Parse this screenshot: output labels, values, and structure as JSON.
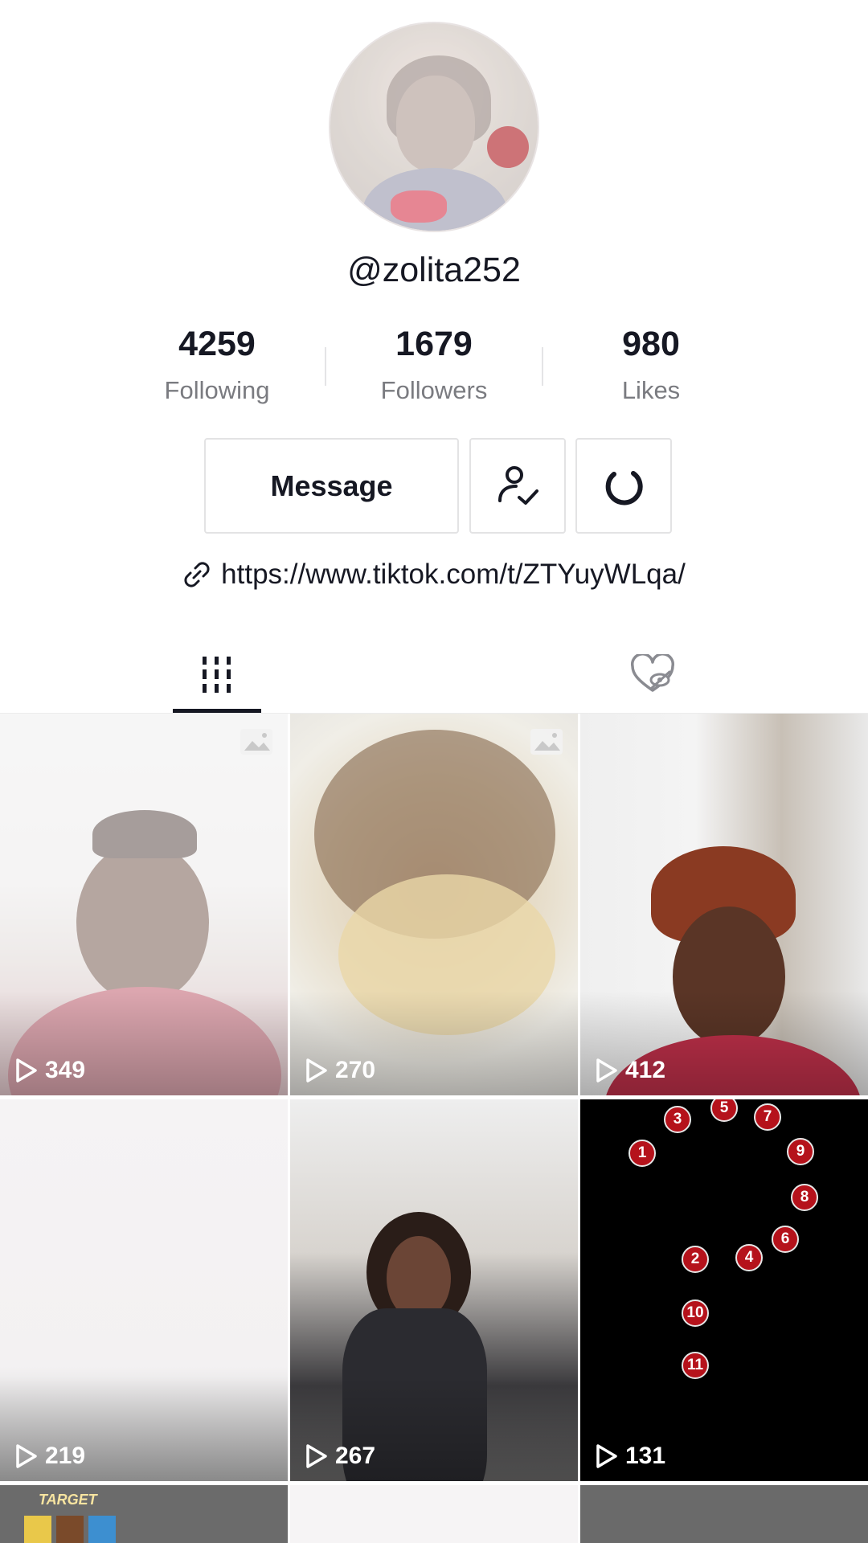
{
  "profile": {
    "username": "@zolita252",
    "stats": [
      {
        "value": "4259",
        "label": "Following"
      },
      {
        "value": "1679",
        "label": "Followers"
      },
      {
        "value": "980",
        "label": "Likes"
      }
    ],
    "message_label": "Message",
    "link": "https://www.tiktok.com/t/ZTYuyWLqa/"
  },
  "icons": {
    "following": "person-check-icon",
    "more": "refresh-icon",
    "link": "link-icon",
    "tab_videos": "grid-icon",
    "tab_liked": "heart-hidden-icon",
    "play": "play-icon",
    "photo": "photo-icon"
  },
  "videos": [
    {
      "views": "349"
    },
    {
      "views": "270"
    },
    {
      "views": "412"
    },
    {
      "views": "219"
    },
    {
      "views": "267"
    },
    {
      "views": "131"
    }
  ],
  "number_video": {
    "dots": [
      "1",
      "2",
      "3",
      "4",
      "5",
      "6",
      "7",
      "8",
      "9",
      "10",
      "11"
    ]
  },
  "thumb_text": {
    "store": "TARGET"
  }
}
